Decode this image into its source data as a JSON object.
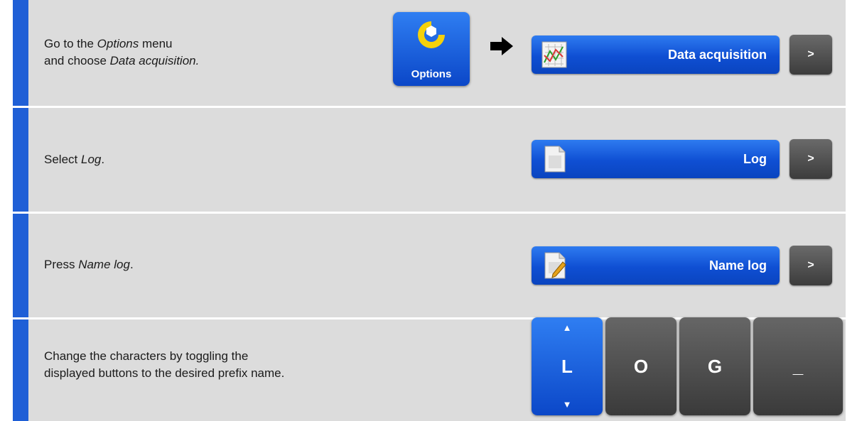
{
  "steps": [
    {
      "line1_a": "Go to the ",
      "line1_b": "Options",
      "line1_c": " menu",
      "line2_a": "and choose ",
      "line2_b": "Data acquisition."
    },
    {
      "text_a": "Select ",
      "text_b": "Log",
      "text_c": "."
    },
    {
      "text_a": "Press ",
      "text_b": "Name log",
      "text_c": "."
    },
    {
      "line1": "Change the characters by toggling the",
      "line2": "displayed buttons to the desired prefix name."
    }
  ],
  "options_button": {
    "label": "Options",
    "icon": "wrench-icon"
  },
  "menu_buttons": [
    {
      "label": "Data acquisition",
      "icon": "chart-icon",
      "arrow": ">"
    },
    {
      "label": "Log",
      "icon": "document-icon",
      "arrow": ">"
    },
    {
      "label": "Name log",
      "icon": "document-edit-icon",
      "arrow": ">"
    }
  ],
  "char_keys": [
    {
      "char": "L",
      "up": "▲",
      "down": "▼",
      "selected": true
    },
    {
      "char": "O",
      "selected": false
    },
    {
      "char": "G",
      "selected": false
    },
    {
      "char": "_",
      "selected": false
    }
  ],
  "colors": {
    "accent": "#1f5fd6",
    "panel": "#dcdcdc",
    "button_blue": "#0f4fd3",
    "button_dark": "#4a4a4a",
    "options_icon": "#f5d10a"
  }
}
